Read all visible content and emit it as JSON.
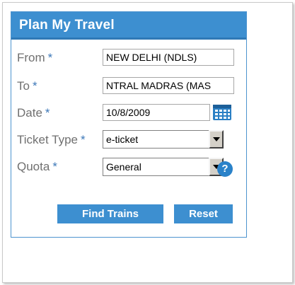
{
  "panel": {
    "title": "Plan My Travel"
  },
  "form": {
    "required_mark": "*",
    "from": {
      "label": "From",
      "value": "NEW DELHI (NDLS)"
    },
    "to": {
      "label": "To",
      "value": "NTRAL MADRAS (MAS"
    },
    "date": {
      "label": "Date",
      "value": "10/8/2009"
    },
    "ticket_type": {
      "label": "Ticket Type",
      "value": "e-ticket"
    },
    "quota": {
      "label": "Quota",
      "value": "General"
    }
  },
  "icons": {
    "calendar": "calendar-icon",
    "help": "help-icon",
    "help_glyph": "?"
  },
  "buttons": {
    "find_trains": "Find Trains",
    "reset": "Reset"
  },
  "colors": {
    "accent": "#3d8fd0",
    "label_text": "#707070",
    "required_mark": "#3d78b8"
  }
}
